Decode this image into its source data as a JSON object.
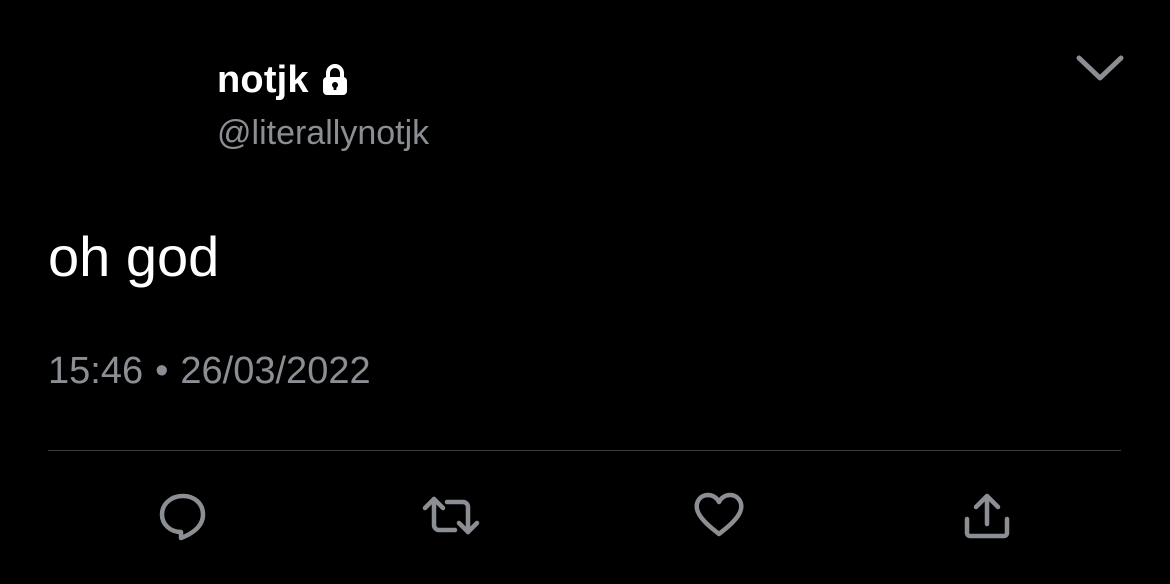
{
  "tweet": {
    "display_name": "notjk",
    "handle": "@literallynotjk",
    "text": "oh god",
    "time": "15:46",
    "separator": "•",
    "date": "26/03/2022",
    "protected_icon": "lock-icon",
    "menu_icon": "chevron-down-icon"
  },
  "actions": [
    {
      "name": "reply",
      "icon": "comment-icon"
    },
    {
      "name": "retweet",
      "icon": "retweet-icon"
    },
    {
      "name": "like",
      "icon": "heart-icon"
    },
    {
      "name": "share",
      "icon": "share-icon"
    }
  ],
  "colors": {
    "background": "#000000",
    "primary_text": "#ffffff",
    "secondary_text": "#8b8f93",
    "divider": "#3a3d40"
  }
}
